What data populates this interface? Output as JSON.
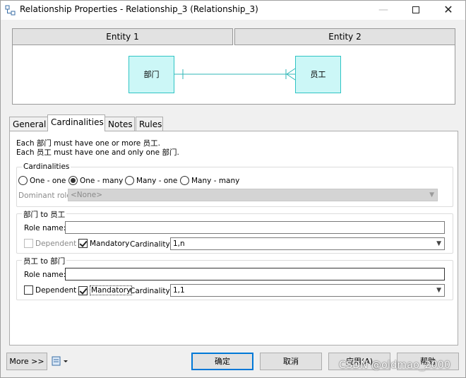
{
  "window": {
    "title": "Relationship Properties - Relationship_3 (Relationship_3)"
  },
  "entities": {
    "header1": "Entity 1",
    "header2": "Entity 2",
    "entity1_name": "部门",
    "entity2_name": "员工"
  },
  "tabs": [
    {
      "label": "General",
      "active": false
    },
    {
      "label": "Cardinalities",
      "active": true
    },
    {
      "label": "Notes",
      "active": false
    },
    {
      "label": "Rules",
      "active": false
    }
  ],
  "description": {
    "line1": "Each 部门 must have one or more 员工.",
    "line2": "Each 员工 must have one and only one 部门."
  },
  "cardinalities": {
    "group_title": "Cardinalities",
    "options": [
      {
        "label": "One - one",
        "selected": false
      },
      {
        "label": "One - many",
        "selected": true
      },
      {
        "label": "Many - one",
        "selected": false
      },
      {
        "label": "Many - many",
        "selected": false
      }
    ],
    "dominant_role_label": "Dominant role:",
    "dominant_role_value": "<None>"
  },
  "role1": {
    "group_title": "部门 to 员工",
    "role_name_label": "Role name:",
    "role_name_value": "",
    "dependent_label": "Dependent",
    "dependent_checked": false,
    "dependent_enabled": false,
    "mandatory_label": "Mandatory",
    "mandatory_checked": true,
    "cardinality_label": "Cardinality:",
    "cardinality_value": "1,n"
  },
  "role2": {
    "group_title": "员工 to 部门",
    "role_name_label": "Role name:",
    "role_name_value": "",
    "dependent_label": "Dependent",
    "dependent_checked": false,
    "dependent_enabled": true,
    "mandatory_label": "Mandatory",
    "mandatory_checked": true,
    "cardinality_label": "Cardinality:",
    "cardinality_value": "1,1"
  },
  "footer": {
    "more_label": "More >>",
    "ok_label": "确定",
    "cancel_label": "取消",
    "apply_label": "应用(A)",
    "help_label": "帮助"
  },
  "watermark": "CSDN @oldmao_2000",
  "colors": {
    "entity_fill": "#ccf7f7",
    "entity_border": "#30c4c4",
    "accent": "#0078d7"
  }
}
